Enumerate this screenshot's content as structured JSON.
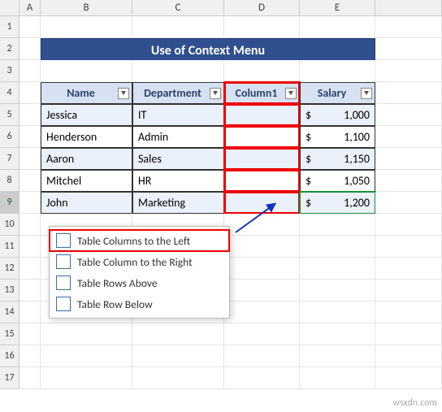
{
  "columns": [
    "A",
    "B",
    "C",
    "D",
    "E"
  ],
  "rows": [
    "1",
    "2",
    "3",
    "4",
    "5",
    "6",
    "7",
    "8",
    "9",
    "10",
    "11",
    "12",
    "13",
    "14",
    "15",
    "16",
    "17"
  ],
  "title": "Use of Context Menu",
  "headers": {
    "name": "Name",
    "dept": "Department",
    "col1": "Column1",
    "salary": "Salary"
  },
  "table": [
    {
      "name": "Jessica",
      "dept": "IT",
      "sal": "1,000"
    },
    {
      "name": "Henderson",
      "dept": "Admin",
      "sal": "1,100"
    },
    {
      "name": "Aaron",
      "dept": "Sales",
      "sal": "1,150"
    },
    {
      "name": "Mitchel",
      "dept": "HR",
      "sal": "1,050"
    },
    {
      "name": "John",
      "dept": "Marketing",
      "sal": "1,200"
    }
  ],
  "currency": "$",
  "menu": {
    "cols_left": "Table Columns to the Left",
    "cols_right": "Table Column to the Right",
    "rows_above": "Table Rows Above",
    "rows_below": "Table Row Below"
  },
  "watermark": "wsxdn.com"
}
